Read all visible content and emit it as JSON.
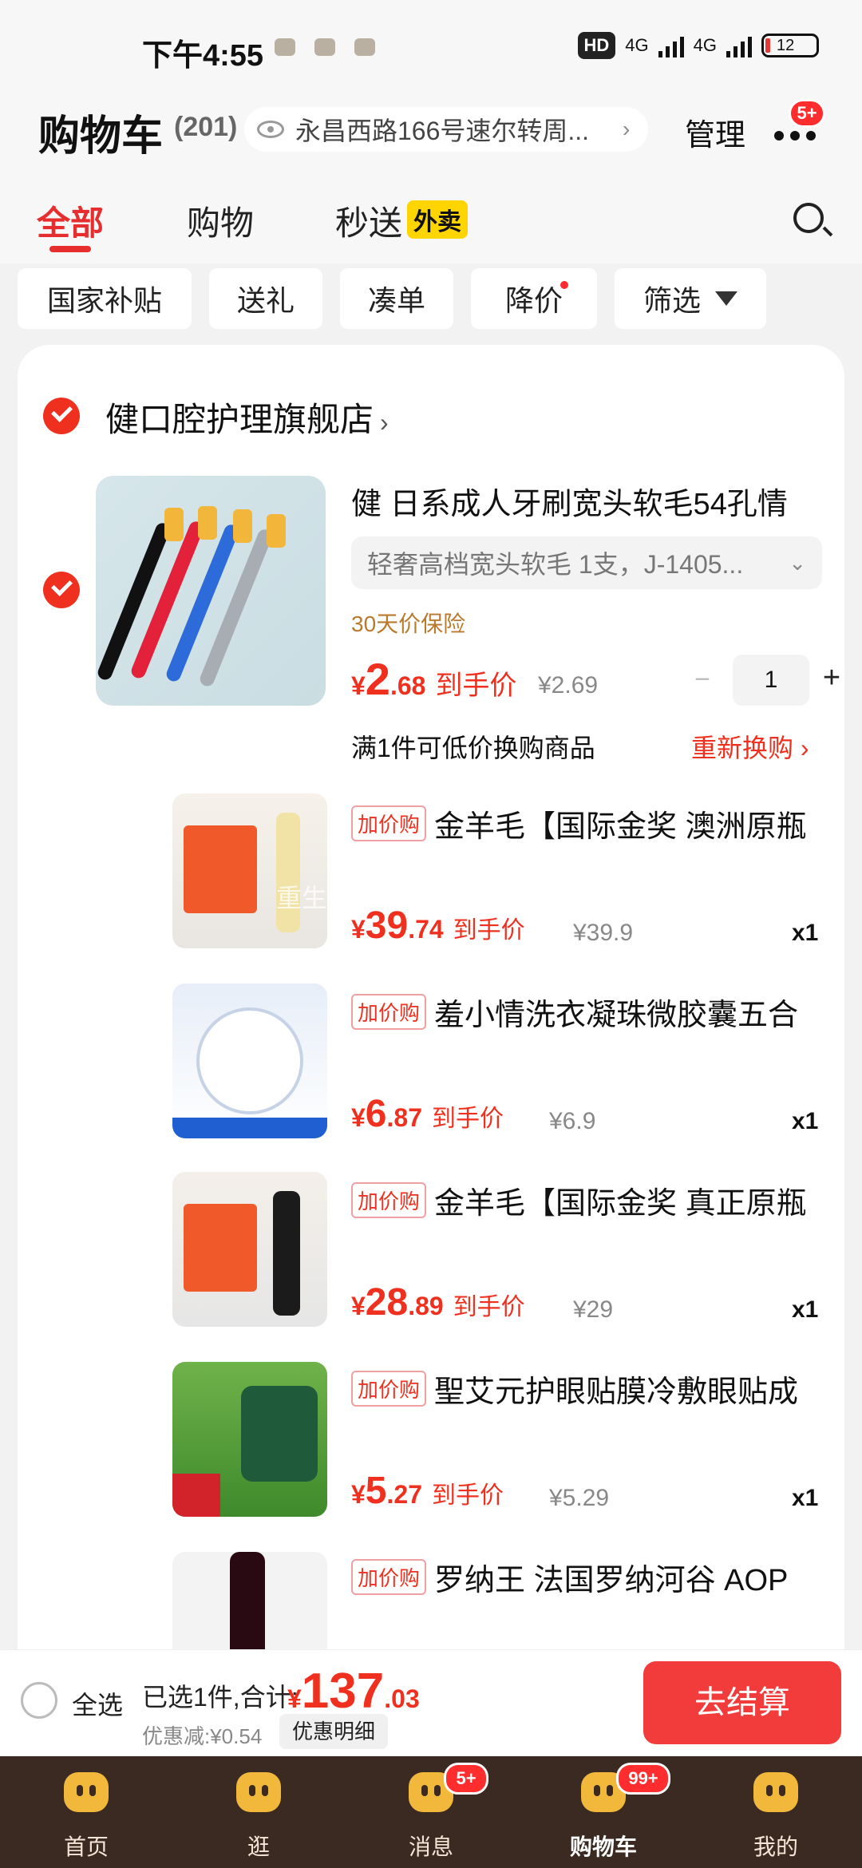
{
  "status_bar": {
    "time": "下午4:55",
    "hd": "HD",
    "net1": "4G",
    "net2": "4G",
    "battery": "12"
  },
  "header": {
    "title": "购物车",
    "count": "(201)",
    "address": "永昌西路166号速尔转周...",
    "manage": "管理",
    "more_badge": "5+"
  },
  "tabs": [
    {
      "label": "全部"
    },
    {
      "label": "购物"
    },
    {
      "label": "秒送"
    }
  ],
  "tab_tag": "外卖",
  "filters": [
    "国家补贴",
    "送礼",
    "凑单",
    "降价",
    "筛选"
  ],
  "store": {
    "name": "健口腔护理旗舰店"
  },
  "main_item": {
    "title": "健 日系成人牙刷宽头软毛54孔情",
    "sku": "轻奢高档宽头软毛 1支，J-1405...",
    "insurance": "30天价保险",
    "price_int": "2",
    "price_dec": ".68",
    "price_label": "到手价",
    "old_price": "¥2.69",
    "qty": "1",
    "promo": "满1件可低价换购商品",
    "rebuy": "重新换购 ›"
  },
  "addon_tag": "加价购",
  "addons": [
    {
      "title": "金羊毛【国际金奖 澳洲原瓶",
      "price_int": "39",
      "price_dec": ".74",
      "label": "到手价",
      "old": "¥39.9",
      "qty": "x1"
    },
    {
      "title": "羞小情洗衣凝珠微胶囊五合",
      "price_int": "6",
      "price_dec": ".87",
      "label": "到手价",
      "old": "¥6.9",
      "qty": "x1"
    },
    {
      "title": "金羊毛【国际金奖 真正原瓶",
      "price_int": "28",
      "price_dec": ".89",
      "label": "到手价",
      "old": "¥29",
      "qty": "x1"
    },
    {
      "title": "聖艾元护眼贴膜冷敷眼贴成",
      "price_int": "5",
      "price_dec": ".27",
      "label": "到手价",
      "old": "¥5.29",
      "qty": "x1"
    },
    {
      "title": "罗纳王 法国罗纳河谷 AOP"
    }
  ],
  "watermark": "重生之首富白月光",
  "checkout": {
    "select_all": "全选",
    "selected": "已选1件,合计:",
    "yen": "¥",
    "total_int": "137",
    "total_dec": ".03",
    "discount": "优惠减:¥0.54",
    "detail": "优惠明细",
    "go": "去结算"
  },
  "nav": [
    {
      "label": "首页"
    },
    {
      "label": "逛"
    },
    {
      "label": "消息",
      "badge": "5+"
    },
    {
      "label": "购物车",
      "badge": "99+"
    },
    {
      "label": "我的"
    }
  ],
  "colors": {
    "accent": "#f0301f",
    "nav_bg": "#3a2a22",
    "tag_yellow": "#ffd500"
  }
}
